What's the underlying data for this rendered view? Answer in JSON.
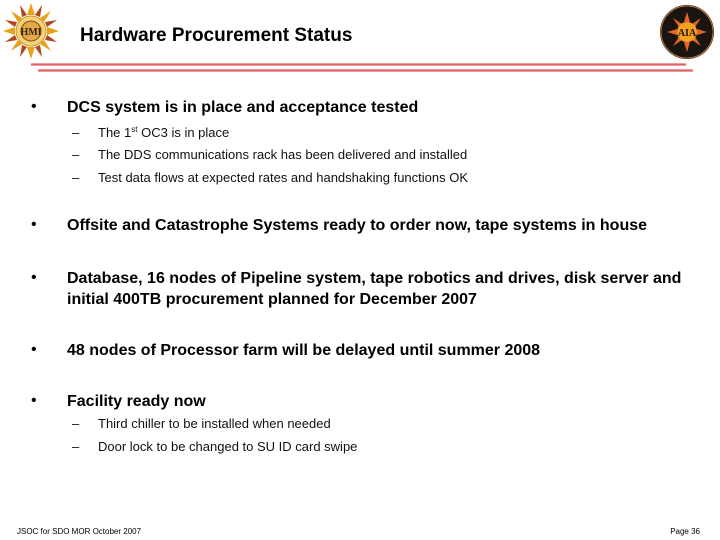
{
  "slide": {
    "title": "Hardware Procurement Status",
    "logos": {
      "left": "HMI",
      "right": "AIA"
    },
    "bullets": [
      {
        "text": "DCS system is in place and acceptance tested",
        "sub": [
          {
            "pre": "The 1",
            "sup": "st",
            "post": " OC3 is in place"
          },
          {
            "text": "The DDS communications rack has been delivered and installed"
          },
          {
            "text": "Test data flows at expected rates and handshaking functions OK"
          }
        ]
      },
      {
        "text": "Offsite and Catastrophe Systems ready to order now, tape systems in house"
      },
      {
        "line1": "Database, 16 nodes of Pipeline system, tape robotics and drives, disk server and",
        "line2": "initial 400TB procurement planned for December 2007"
      },
      {
        "text": "48 nodes of Processor farm will be delayed until summer 2008"
      },
      {
        "text": "Facility ready now",
        "sub": [
          {
            "text": "Third chiller to be installed when needed"
          },
          {
            "text": "Door lock to be changed to SU ID card swipe"
          }
        ]
      }
    ],
    "bullet_glyph": "•",
    "dash_glyph": "–",
    "footer": {
      "left": "JSOC for SDO MOR October 2007",
      "right": "Page 36"
    }
  }
}
